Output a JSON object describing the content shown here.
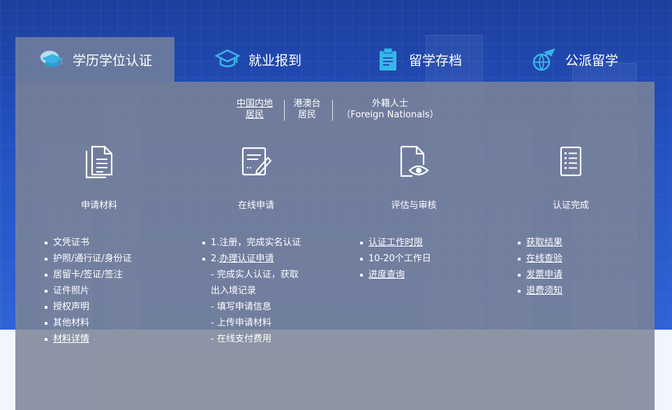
{
  "tabs": [
    {
      "label": "学历学位认证",
      "icon": "graduation-cap-icon",
      "active": true
    },
    {
      "label": "就业报到",
      "icon": "employment-cap-icon",
      "active": false
    },
    {
      "label": "留学存档",
      "icon": "archive-document-icon",
      "active": false
    },
    {
      "label": "公派留学",
      "icon": "airplane-globe-icon",
      "active": false
    }
  ],
  "subtabs": [
    {
      "line1": "中国内地",
      "line2": "居民",
      "active": true
    },
    {
      "line1": "港澳台",
      "line2": "居民",
      "active": false
    },
    {
      "line1": "外籍人士",
      "line2": "（Foreign Nationals）",
      "active": false
    }
  ],
  "steps": [
    {
      "label": "申请材料",
      "icon": "documents-icon"
    },
    {
      "label": "在线申请",
      "icon": "edit-form-icon"
    },
    {
      "label": "评估与审核",
      "icon": "review-eye-icon"
    },
    {
      "label": "认证完成",
      "icon": "checklist-icon"
    }
  ],
  "columns": {
    "materials": [
      "文凭证书",
      "护照/通行证/身份证",
      "居留卡/签证/签注",
      "证件照片",
      "授权声明",
      "其他材料",
      "材料详情"
    ],
    "online": {
      "item1": "1.注册，完成实名认证",
      "item2_prefix": "2.",
      "item2_link": "办理认证申请",
      "sub1a": "- 完成实人认证，获取",
      "sub1b": "出入境记录",
      "sub2": "- 填写申请信息",
      "sub3": "- 上传申请材料",
      "sub4": "- 在线支付费用"
    },
    "review": [
      "认证工作时限",
      "10-20个工作日",
      "进度查询"
    ],
    "complete": [
      "获取结果",
      "在线查验",
      "发票申请",
      "退费须知"
    ]
  },
  "colors": {
    "panel": "#7d8496",
    "accent_blue": "#2f63d6",
    "icon_cyan": "#39b6e8"
  }
}
